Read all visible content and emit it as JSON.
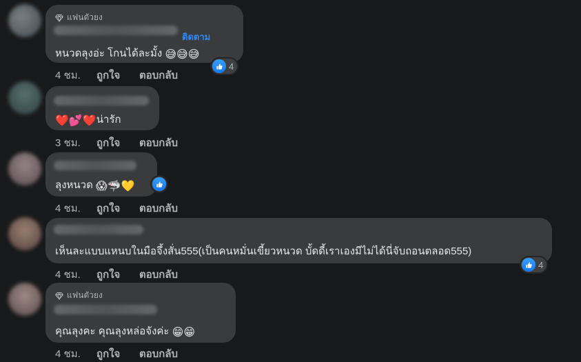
{
  "comments": [
    {
      "badge": "แฟนตัวยง",
      "follow": "ติดตาม",
      "text": "หนวดลุงอ่ะ โกนได้ละมั้ง",
      "emojis": "😅😅😅",
      "reaction_count": "4",
      "time": "4 ชม.",
      "like": "ถูกใจ",
      "reply": "ตอบกลับ"
    },
    {
      "text": "น่ารัก",
      "emojis_before": "❤️💕❤️",
      "time": "3 ชม.",
      "like": "ถูกใจ",
      "reply": "ตอบกลับ"
    },
    {
      "text": "ลุงหนวด",
      "emojis": "😱🦈💛",
      "time": "4 ชม.",
      "like": "ถูกใจ",
      "reply": "ตอบกลับ"
    },
    {
      "text": "เห็นละแบบแหนบในมือจึ้งสั่น555(เป็นคนหมั่นเขี้ยวหนวด บั้ดดี้เราเองมีไม่ได้นี่จับถอนตลอด555)",
      "reaction_count": "4",
      "time": "4 ชม.",
      "like": "ถูกใจ",
      "reply": "ตอบกลับ"
    },
    {
      "badge": "แฟนตัวยง",
      "text": "คุณลุงคะ คุณลุงหล่อจังค่ะ",
      "emojis": "😁😁",
      "time": "4 ชม.",
      "like": "ถูกใจ",
      "reply": "ตอบกลับ"
    }
  ],
  "colors": {
    "background": "#18191a",
    "bubble": "#3a3b3c",
    "text": "#e4e6eb",
    "secondary": "#b0b3b8",
    "link": "#2d88ff",
    "like_blue": "#1877f2"
  },
  "icons": {
    "badge": "diamond-icon",
    "reaction": "thumbs-up-icon"
  }
}
